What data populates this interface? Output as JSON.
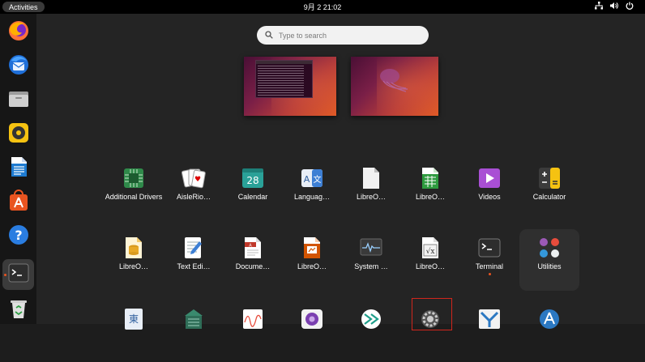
{
  "topbar": {
    "activities": "Activities",
    "clock": "9月 2  21:02"
  },
  "search": {
    "placeholder": "Type to search"
  },
  "apps": [
    {
      "label": "Additional Drivers",
      "icon": "chip-icon"
    },
    {
      "label": "AisleRio…",
      "icon": "cards-icon"
    },
    {
      "label": "Calendar",
      "icon": "calendar-icon",
      "badge": "28"
    },
    {
      "label": "Languag…",
      "icon": "language-icon"
    },
    {
      "label": "LibreO…",
      "icon": "libreoffice-icon"
    },
    {
      "label": "LibreO…",
      "icon": "libreoffice-calc-icon"
    },
    {
      "label": "Videos",
      "icon": "videos-icon"
    },
    {
      "label": "Calculator",
      "icon": "calculator-icon"
    },
    {
      "label": "LibreO…",
      "icon": "libreoffice-base-icon"
    },
    {
      "label": "Text Edi…",
      "icon": "text-editor-icon"
    },
    {
      "label": "Docume…",
      "icon": "document-viewer-icon"
    },
    {
      "label": "LibreO…",
      "icon": "libreoffice-impress-icon"
    },
    {
      "label": "System …",
      "icon": "system-monitor-icon"
    },
    {
      "label": "LibreO…",
      "icon": "libreoffice-math-icon"
    },
    {
      "label": "Terminal",
      "icon": "terminal-icon",
      "running": true
    },
    {
      "label": "Utilities",
      "icon": "utilities-folder-icon",
      "folder": true
    }
  ],
  "dock": [
    {
      "name": "firefox-icon"
    },
    {
      "name": "thunderbird-icon"
    },
    {
      "name": "files-icon"
    },
    {
      "name": "rhythmbox-icon"
    },
    {
      "name": "libreoffice-writer-icon"
    },
    {
      "name": "app-center-icon"
    },
    {
      "name": "help-icon"
    },
    {
      "name": "terminal-icon",
      "active": true
    },
    {
      "name": "trash-icon"
    }
  ],
  "colors": {
    "accent": "#e95420",
    "panel": "#000000",
    "overview_bg": "#242424",
    "selection_outline": "#d0261c"
  }
}
